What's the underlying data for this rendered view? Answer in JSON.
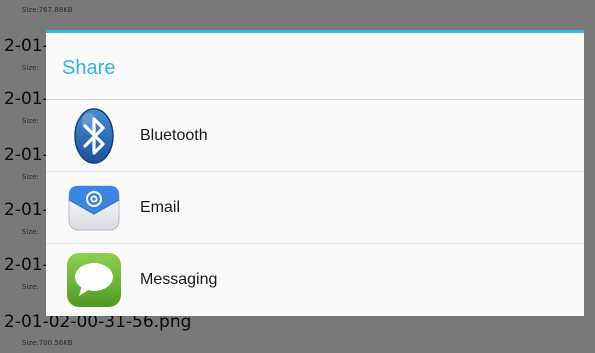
{
  "background_list": {
    "items": [
      {
        "name": "2-01-",
        "size": "Size:767.88KB"
      },
      {
        "name": "2-01-",
        "size": "Size:"
      },
      {
        "name": "2-01-",
        "size": "Size:"
      },
      {
        "name": "2-01-",
        "size": "Size:"
      },
      {
        "name": "2-01-",
        "size": "Size:"
      },
      {
        "name": "2-01-",
        "size": "Size:"
      },
      {
        "name": "2-01-02-00-31-56.png",
        "size": "Size:700.56KB"
      }
    ]
  },
  "dialog": {
    "title": "Share",
    "accent_color": "#33b5e5",
    "options": [
      {
        "label": "Bluetooth",
        "icon": "bluetooth-icon"
      },
      {
        "label": "Email",
        "icon": "email-icon"
      },
      {
        "label": "Messaging",
        "icon": "messaging-icon"
      }
    ]
  }
}
